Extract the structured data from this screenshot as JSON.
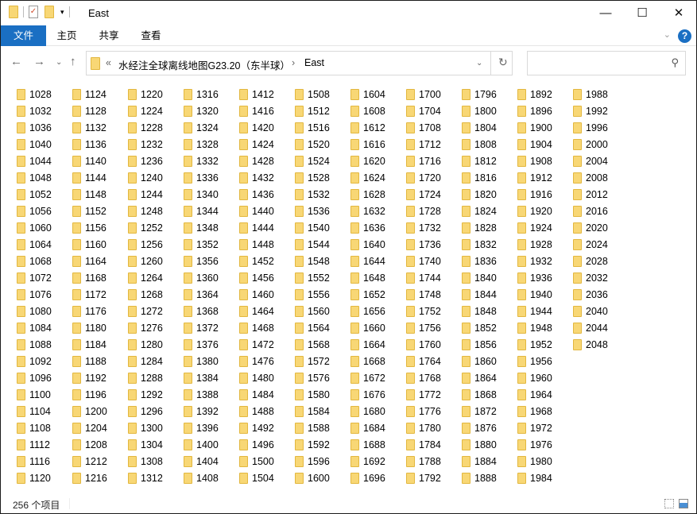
{
  "window": {
    "title": "East"
  },
  "ribbon": {
    "tabs": [
      "文件",
      "主页",
      "共享",
      "查看"
    ]
  },
  "address": {
    "overflow": "«",
    "parent": "水经注全球离线地图G23.20（东半球）",
    "separator": "›",
    "current": "East"
  },
  "search": {
    "placeholder": ""
  },
  "status": {
    "count": "256 个项目"
  },
  "colors": {
    "accent": "#1a6fc3",
    "folder": "#f8d775"
  },
  "folders": [
    "1028",
    "1032",
    "1036",
    "1040",
    "1044",
    "1048",
    "1052",
    "1056",
    "1060",
    "1064",
    "1068",
    "1072",
    "1076",
    "1080",
    "1084",
    "1088",
    "1092",
    "1096",
    "1100",
    "1104",
    "1108",
    "1112",
    "1116",
    "1120",
    "1124",
    "1128",
    "1132",
    "1136",
    "1140",
    "1144",
    "1148",
    "1152",
    "1156",
    "1160",
    "1164",
    "1168",
    "1172",
    "1176",
    "1180",
    "1184",
    "1188",
    "1192",
    "1196",
    "1200",
    "1204",
    "1208",
    "1212",
    "1216",
    "1220",
    "1224",
    "1228",
    "1232",
    "1236",
    "1240",
    "1244",
    "1248",
    "1252",
    "1256",
    "1260",
    "1264",
    "1268",
    "1272",
    "1276",
    "1280",
    "1284",
    "1288",
    "1292",
    "1296",
    "1300",
    "1304",
    "1308",
    "1312",
    "1316",
    "1320",
    "1324",
    "1328",
    "1332",
    "1336",
    "1340",
    "1344",
    "1348",
    "1352",
    "1356",
    "1360",
    "1364",
    "1368",
    "1372",
    "1376",
    "1380",
    "1384",
    "1388",
    "1392",
    "1396",
    "1400",
    "1404",
    "1408",
    "1412",
    "1416",
    "1420",
    "1424",
    "1428",
    "1432",
    "1436",
    "1440",
    "1444",
    "1448",
    "1452",
    "1456",
    "1460",
    "1464",
    "1468",
    "1472",
    "1476",
    "1480",
    "1484",
    "1488",
    "1492",
    "1496",
    "1500",
    "1504",
    "1508",
    "1512",
    "1516",
    "1520",
    "1524",
    "1528",
    "1532",
    "1536",
    "1540",
    "1544",
    "1548",
    "1552",
    "1556",
    "1560",
    "1564",
    "1568",
    "1572",
    "1576",
    "1580",
    "1584",
    "1588",
    "1592",
    "1596",
    "1600",
    "1604",
    "1608",
    "1612",
    "1616",
    "1620",
    "1624",
    "1628",
    "1632",
    "1636",
    "1640",
    "1644",
    "1648",
    "1652",
    "1656",
    "1660",
    "1664",
    "1668",
    "1672",
    "1676",
    "1680",
    "1684",
    "1688",
    "1692",
    "1696",
    "1700",
    "1704",
    "1708",
    "1712",
    "1716",
    "1720",
    "1724",
    "1728",
    "1732",
    "1736",
    "1740",
    "1744",
    "1748",
    "1752",
    "1756",
    "1760",
    "1764",
    "1768",
    "1772",
    "1776",
    "1780",
    "1784",
    "1788",
    "1792",
    "1796",
    "1800",
    "1804",
    "1808",
    "1812",
    "1816",
    "1820",
    "1824",
    "1828",
    "1832",
    "1836",
    "1840",
    "1844",
    "1848",
    "1852",
    "1856",
    "1860",
    "1864",
    "1868",
    "1872",
    "1876",
    "1880",
    "1884",
    "1888",
    "1892",
    "1896",
    "1900",
    "1904",
    "1908",
    "1912",
    "1916",
    "1920",
    "1924",
    "1928",
    "1932",
    "1936",
    "1940",
    "1944",
    "1948",
    "1952",
    "1956",
    "1960",
    "1964",
    "1968",
    "1972",
    "1976",
    "1980",
    "1984",
    "1988",
    "1992",
    "1996",
    "2000",
    "2004",
    "2008",
    "2012",
    "2016",
    "2020",
    "2024",
    "2028",
    "2032",
    "2036",
    "2040",
    "2044",
    "2048"
  ]
}
